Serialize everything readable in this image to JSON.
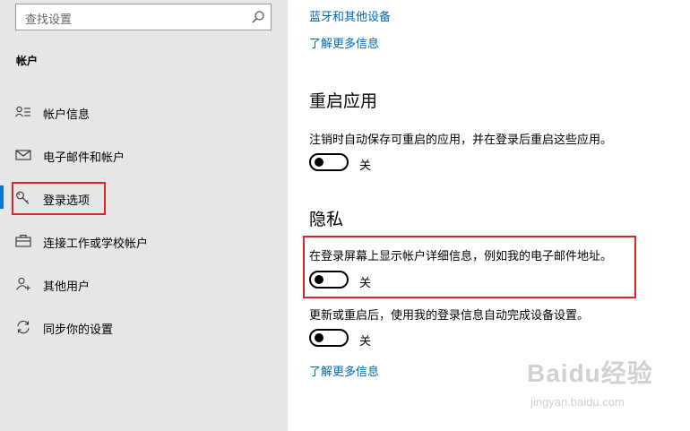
{
  "sidebar": {
    "search": {
      "placeholder": "查找设置",
      "icon": "search-icon"
    },
    "section_title": "帐户",
    "items": [
      {
        "label": "帐户信息",
        "icon": "account-info-icon"
      },
      {
        "label": "电子邮件和帐户",
        "icon": "mail-icon"
      },
      {
        "label": "登录选项",
        "icon": "key-icon",
        "selected": true
      },
      {
        "label": "连接工作或学校帐户",
        "icon": "briefcase-icon"
      },
      {
        "label": "其他用户",
        "icon": "add-person-icon"
      },
      {
        "label": "同步你的设置",
        "icon": "sync-icon"
      }
    ]
  },
  "main": {
    "top_link": "蓝牙和其他设备",
    "learn_more_1": "了解更多信息",
    "restart_apps": {
      "heading": "重启应用",
      "description": "注销时自动保存可重启的应用，并在登录后重启这些应用。",
      "toggle_state": "关"
    },
    "privacy": {
      "heading": "隐私",
      "show_details": {
        "description": "在登录屏幕上显示帐户详细信息，例如我的电子邮件地址。",
        "toggle_state": "关"
      },
      "auto_finish": {
        "description": "更新或重启后，使用我的登录信息自动完成设备设置。",
        "toggle_state": "关"
      }
    },
    "learn_more_2": "了解更多信息"
  },
  "watermark": {
    "logo": "Baidu经验",
    "sub": "jingyan.baidu.com"
  },
  "colors": {
    "accent": "#0078d7",
    "link": "#0067b8",
    "highlight": "#d8242a",
    "sidebar_bg": "#e6e6e6"
  }
}
